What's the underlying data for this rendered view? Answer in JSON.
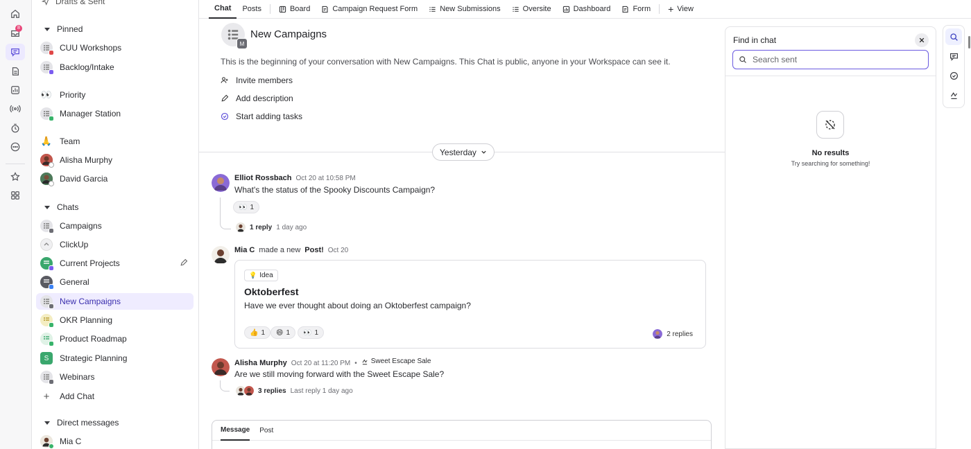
{
  "rail": {
    "inbox_badge": "8"
  },
  "sidebar": {
    "top_label": "Drafts & Sent",
    "sections": {
      "pinned": "Pinned",
      "priority": "Priority",
      "team": "Team",
      "chats": "Chats",
      "direct": "Direct messages"
    },
    "pinned": [
      {
        "label": "CUU Workshops",
        "color": "#e04848"
      },
      {
        "label": "Backlog/Intake",
        "color": "#7b5cf0"
      }
    ],
    "priority": [
      {
        "label": "Manager Station",
        "color": "#38b36a"
      }
    ],
    "team": [
      {
        "label": "Alisha Murphy"
      },
      {
        "label": "David Garcia"
      }
    ],
    "chats": [
      {
        "label": "Campaigns",
        "color": "#6d6e75"
      },
      {
        "label": "ClickUp",
        "color": "#cfcfd4"
      },
      {
        "label": "Current Projects",
        "color": "#7b5cf0"
      },
      {
        "label": "General",
        "color": "#3b82f6"
      },
      {
        "label": "New Campaigns",
        "color": "#6d6e75"
      },
      {
        "label": "OKR Planning",
        "color": "#e2c744"
      },
      {
        "label": "Product Roadmap",
        "color": "#38b36a"
      },
      {
        "label": "Strategic Planning",
        "color": "#3aa76d",
        "letter": "S"
      },
      {
        "label": "Webinars",
        "color": "#6d6e75"
      }
    ],
    "add_chat": "Add Chat",
    "direct": [
      {
        "label": "Mia C"
      }
    ]
  },
  "tabs": {
    "chat": "Chat",
    "posts": "Posts",
    "board": "Board",
    "campaign_form": "Campaign Request Form",
    "new_submissions": "New Submissions",
    "oversite": "Oversite",
    "dashboard": "Dashboard",
    "form": "Form",
    "view": "View"
  },
  "intro": {
    "avatar_letter": "M",
    "title": "New Campaigns",
    "text": "This is the beginning of your conversation with New Campaigns. This Chat is public, anyone in your Workspace can see it.",
    "invite": "Invite members",
    "add_description": "Add description",
    "start_tasks": "Start adding tasks"
  },
  "day_divider": "Yesterday",
  "messages": {
    "m1": {
      "author": "Elliot Rossbach",
      "time": "Oct 20 at 10:58 PM",
      "body": "What's the status of the Spooky Discounts Campaign?",
      "reaction_emoji": "👀",
      "reaction_count": "1",
      "reply_count": "1 reply",
      "reply_meta": "1 day ago"
    },
    "m2": {
      "author": "Mia C",
      "action_pre": "made a new",
      "action_post": "Post!",
      "time": "Oct 20",
      "tag": "Idea",
      "post_title": "Oktoberfest",
      "post_body": "Have we ever thought about doing an Oktoberfest campaign?",
      "reactions": [
        {
          "emoji": "👍",
          "count": "1"
        },
        {
          "emoji": "😄",
          "count": "1"
        },
        {
          "emoji": "👀",
          "count": "1"
        }
      ],
      "replies": "2 replies"
    },
    "m3": {
      "author": "Alisha Murphy",
      "time": "Oct 20 at 11:20 PM",
      "location": "Sweet Escape Sale",
      "body": "Are we still moving forward with the Sweet Escape Sale?",
      "reply_count": "3 replies",
      "reply_meta": "Last reply 1 day ago"
    }
  },
  "composer": {
    "tab_message": "Message",
    "tab_post": "Post"
  },
  "find": {
    "title": "Find in chat",
    "placeholder": "Search sent",
    "no_results": "No results",
    "hint": "Try searching for something!"
  }
}
